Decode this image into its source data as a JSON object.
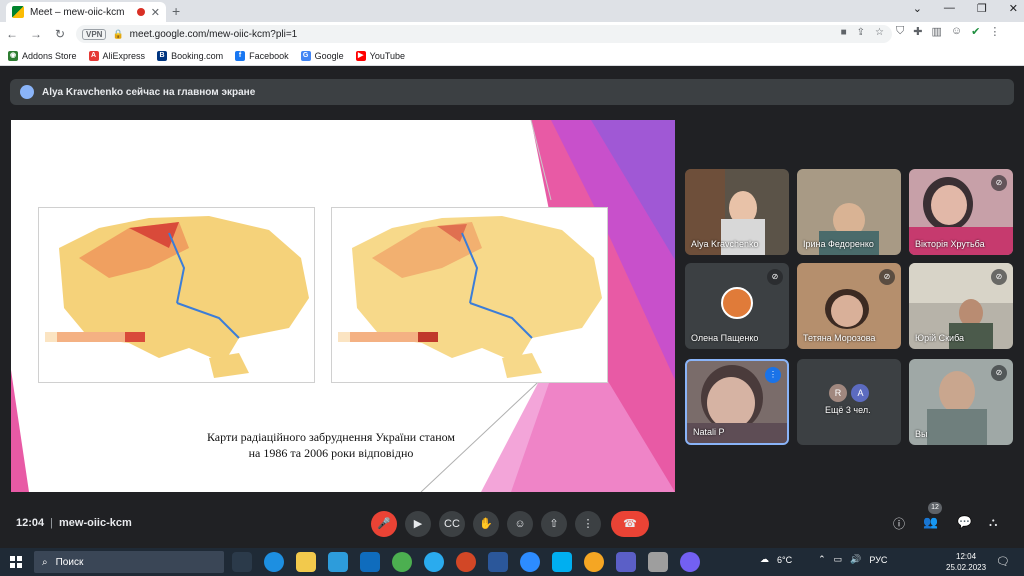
{
  "browser": {
    "tab_title": "Meet – mew-oiic-kcm",
    "new_tab": "+",
    "url": "meet.google.com/mew-oiic-kcm?pli=1",
    "vpn": "VPN",
    "bookmarks": [
      {
        "label": "Addons Store",
        "color": "#2e7d32",
        "glyph": "◉"
      },
      {
        "label": "AliExpress",
        "color": "#e53935",
        "glyph": "A"
      },
      {
        "label": "Booking.com",
        "color": "#003580",
        "glyph": "B"
      },
      {
        "label": "Facebook",
        "color": "#1877f2",
        "glyph": "f"
      },
      {
        "label": "Google",
        "color": "#4285f4",
        "glyph": "G"
      },
      {
        "label": "YouTube",
        "color": "#ff0000",
        "glyph": "▶"
      }
    ]
  },
  "meet": {
    "banner": "Alya Kravchenko сейчас на главном экране",
    "slide": {
      "caption_line1": "Карти радіаційного забруднення України станом",
      "caption_line2": "на 1986 та 2006 роки відповідно"
    },
    "participants": [
      {
        "name": "Alya Kravchenko",
        "muted": false
      },
      {
        "name": "Ірина Федоренко",
        "muted": false
      },
      {
        "name": "Вікторія Хрутьба",
        "muted": true
      },
      {
        "name": "Олена Пащенко",
        "muted": true
      },
      {
        "name": "Тетяна Морозова",
        "muted": true
      },
      {
        "name": "Юрій Скиба",
        "muted": true
      },
      {
        "name": "Natali P",
        "muted": false,
        "speaking": true
      },
      {
        "name": "Ещё 3 чел.",
        "initials": [
          "R",
          "A"
        ]
      },
      {
        "name": "Вы",
        "muted": true
      }
    ],
    "controls": {
      "time": "12:04",
      "meeting_code": "mew-oiic-kcm",
      "people_count": "12"
    }
  },
  "taskbar": {
    "search_placeholder": "Поиск",
    "weather": "6°C",
    "language": "РУС",
    "time": "12:04",
    "date": "25.02.2023"
  }
}
